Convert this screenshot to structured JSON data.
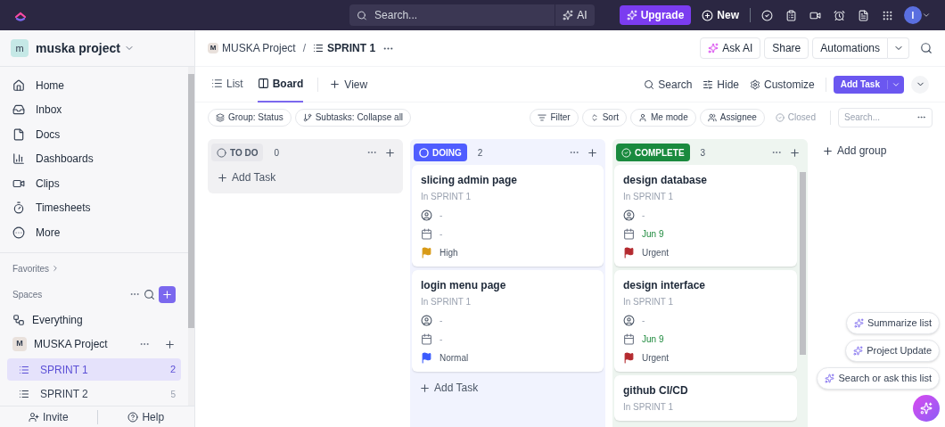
{
  "topbar": {
    "search": {
      "placeholder": "Search..."
    },
    "ai": "AI",
    "upgrade": "Upgrade",
    "new": "New",
    "avatar": "I"
  },
  "sidebar": {
    "workspace": {
      "badge": "m",
      "name": "muska project"
    },
    "nav": [
      {
        "label": "Home"
      },
      {
        "label": "Inbox"
      },
      {
        "label": "Docs"
      },
      {
        "label": "Dashboards"
      },
      {
        "label": "Clips"
      },
      {
        "label": "Timesheets"
      },
      {
        "label": "More"
      }
    ],
    "favorites": "Favorites",
    "spaces": "Spaces",
    "everything": "Everything",
    "space": {
      "badge": "M",
      "name": "MUSKA Project"
    },
    "lists": [
      {
        "label": "SPRINT 1",
        "count": "2",
        "selected": true
      },
      {
        "label": "SPRINT 2",
        "count": "5",
        "selected": false
      }
    ],
    "footer": [
      "Invite",
      "Help"
    ]
  },
  "header": {
    "breadcrumb": {
      "badge": "M",
      "space": "MUSKA Project",
      "separator": "/",
      "list": "SPRINT 1"
    },
    "buttons": [
      "Ask AI",
      "Share",
      "Automations"
    ]
  },
  "views": [
    {
      "label": "List",
      "selected": false
    },
    {
      "label": "Board",
      "selected": true
    }
  ],
  "add_view": "View",
  "view_actions": [
    "Search",
    "Hide",
    "Customize"
  ],
  "add_task": "Add Task",
  "chips_left": [
    "Group: Status",
    "Subtasks: Collapse all"
  ],
  "chips_right": [
    {
      "label": "Filter",
      "disabled": false
    },
    {
      "label": "Sort",
      "disabled": false
    },
    {
      "label": "Me mode",
      "disabled": false
    },
    {
      "label": "Assignee",
      "disabled": false
    },
    {
      "label": "Closed",
      "disabled": true
    }
  ],
  "board_search": {
    "placeholder": "Search..."
  },
  "columns": [
    {
      "status": "TO DO",
      "kind": "todo",
      "color": "#e8e8ec",
      "count": "0",
      "add_task": "Add Task"
    },
    {
      "status": "DOING",
      "kind": "doing",
      "color": "#4f5dff",
      "count": "2",
      "add_task": "Add Task",
      "tasks": [
        {
          "title": "slicing admin page",
          "list": "In SPRINT 1",
          "assignee": "-",
          "date": "-",
          "date_set": false,
          "priority": "High",
          "color": "#d89a16"
        },
        {
          "title": "login menu page",
          "list": "In SPRINT 1",
          "assignee": "-",
          "date": "-",
          "date_set": false,
          "priority": "Normal",
          "color": "#3b5bfd"
        }
      ]
    },
    {
      "status": "COMPLETE",
      "kind": "complete",
      "color": "#1a8a3e",
      "count": "3",
      "tasks": [
        {
          "title": "design database",
          "list": "In SPRINT 1",
          "assignee": "-",
          "date": "Jun 9",
          "date_set": true,
          "priority": "Urgent",
          "color": "#b42a2f"
        },
        {
          "title": "design interface",
          "list": "In SPRINT 1",
          "assignee": "-",
          "date": "Jun 9",
          "date_set": true,
          "priority": "Urgent",
          "color": "#b42a2f"
        },
        {
          "title": "github CI/CD",
          "list": "In SPRINT 1"
        }
      ]
    }
  ],
  "add_group": "Add group",
  "ai_suggestions": [
    "Summarize list",
    "Project Update",
    "Search or ask this list"
  ]
}
